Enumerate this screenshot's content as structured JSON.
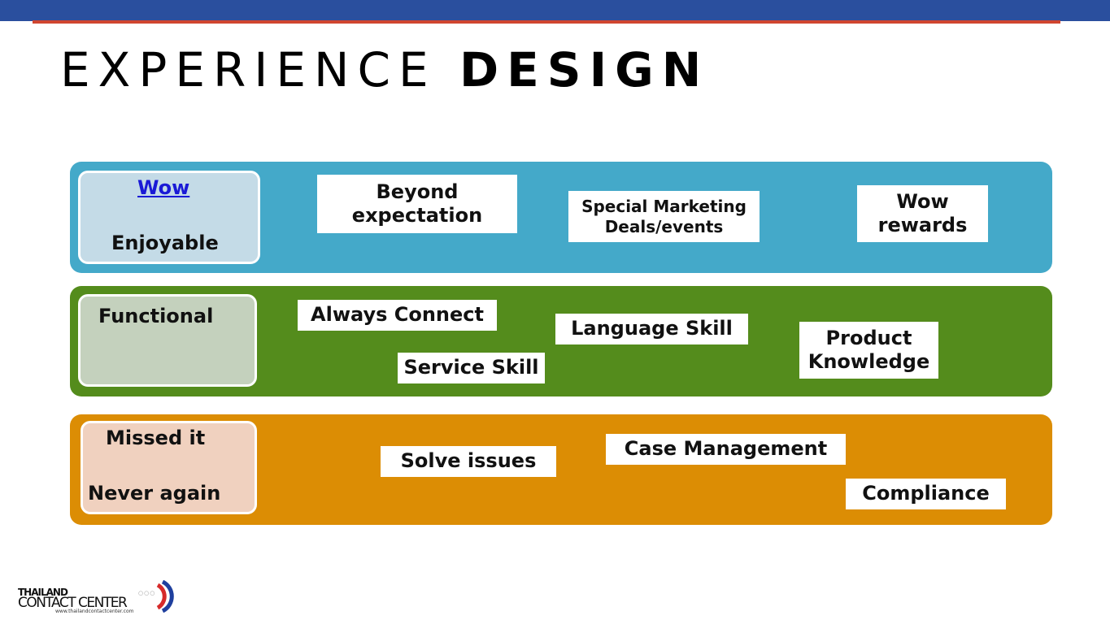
{
  "slide": {
    "title_light": "EXPERIENCE",
    "title_bold": "DESIGN",
    "colors": {
      "top_bar": "#2a4f9e",
      "accent_line": "#d0452f",
      "wow_band": "#44a9c9",
      "functional_band": "#548c1c",
      "missed_band": "#dc8d04",
      "link": "#1a1ad6"
    }
  },
  "levels": {
    "wow": {
      "link_label": "Wow",
      "label": "Enjoyable"
    },
    "functional": {
      "label": "Functional"
    },
    "missed": {
      "label_top": "Missed it",
      "label_bottom": "Never again"
    }
  },
  "items": {
    "beyond_expectation": "Beyond\nexpectation",
    "special_marketing": "Special Marketing\nDeals/events",
    "wow_rewards": "Wow\nrewards",
    "always_connect": "Always Connect",
    "service_skill": "Service Skill",
    "language_skill": "Language Skill",
    "product_knowledge": "Product\nKnowledge",
    "solve_issues": "Solve issues",
    "case_management": "Case Management",
    "compliance": "Compliance"
  },
  "logo": {
    "line1": "THAILAND",
    "line2": "CONTACT CENTER",
    "url": "www.thailandcontactcenter.com",
    "dots": "○○○"
  }
}
